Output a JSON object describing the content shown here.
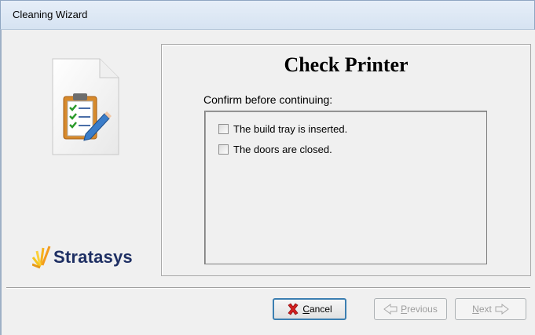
{
  "window": {
    "title": "Cleaning Wizard"
  },
  "sidebar": {
    "logo_text": "Stratasys",
    "icon": "clipboard-checklist-icon"
  },
  "main": {
    "heading": "Check Printer",
    "prompt": "Confirm before continuing:",
    "checklist": [
      {
        "label": "The build tray is inserted.",
        "checked": false
      },
      {
        "label": "The doors are closed.",
        "checked": false
      }
    ]
  },
  "buttons": {
    "cancel": {
      "mnemonic": "C",
      "rest": "ancel",
      "icon": "red-x-icon"
    },
    "previous": {
      "mnemonic": "P",
      "rest": "revious",
      "enabled": false,
      "icon": "back-arrow-icon"
    },
    "next": {
      "mnemonic": "N",
      "rest": "ext",
      "enabled": false,
      "icon": "forward-arrow-icon"
    }
  },
  "colors": {
    "logo_text": "#1e2f63",
    "cancel_x": "#d42020",
    "accent_border": "#3c7fb1"
  }
}
